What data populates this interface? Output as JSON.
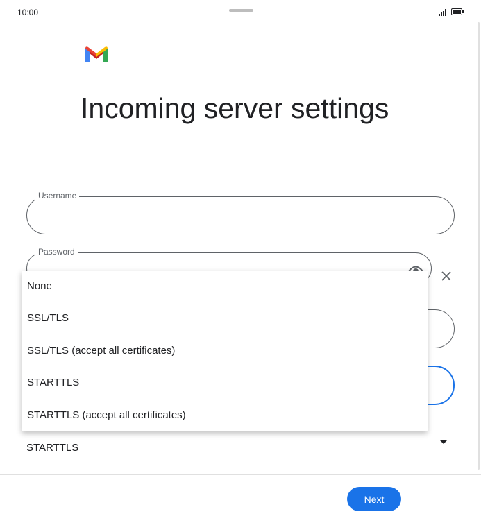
{
  "status_bar": {
    "time": "10:00",
    "icons": [
      "signal-icon",
      "battery-icon"
    ]
  },
  "header": {
    "logo": "gmail-logo",
    "title": "Incoming server settings"
  },
  "form": {
    "username": {
      "label": "Username",
      "value": ""
    },
    "password": {
      "label": "Password",
      "value": ""
    },
    "security": {
      "selected": "STARTTLS"
    }
  },
  "dropdown": {
    "options": [
      "None",
      "SSL/TLS",
      "SSL/TLS (accept all certificates)",
      "STARTTLS",
      "STARTTLS (accept all certificates)"
    ]
  },
  "footer": {
    "next_label": "Next"
  },
  "colors": {
    "accent": "#1a73e8",
    "text": "#202124",
    "outline": "#5f6368"
  }
}
